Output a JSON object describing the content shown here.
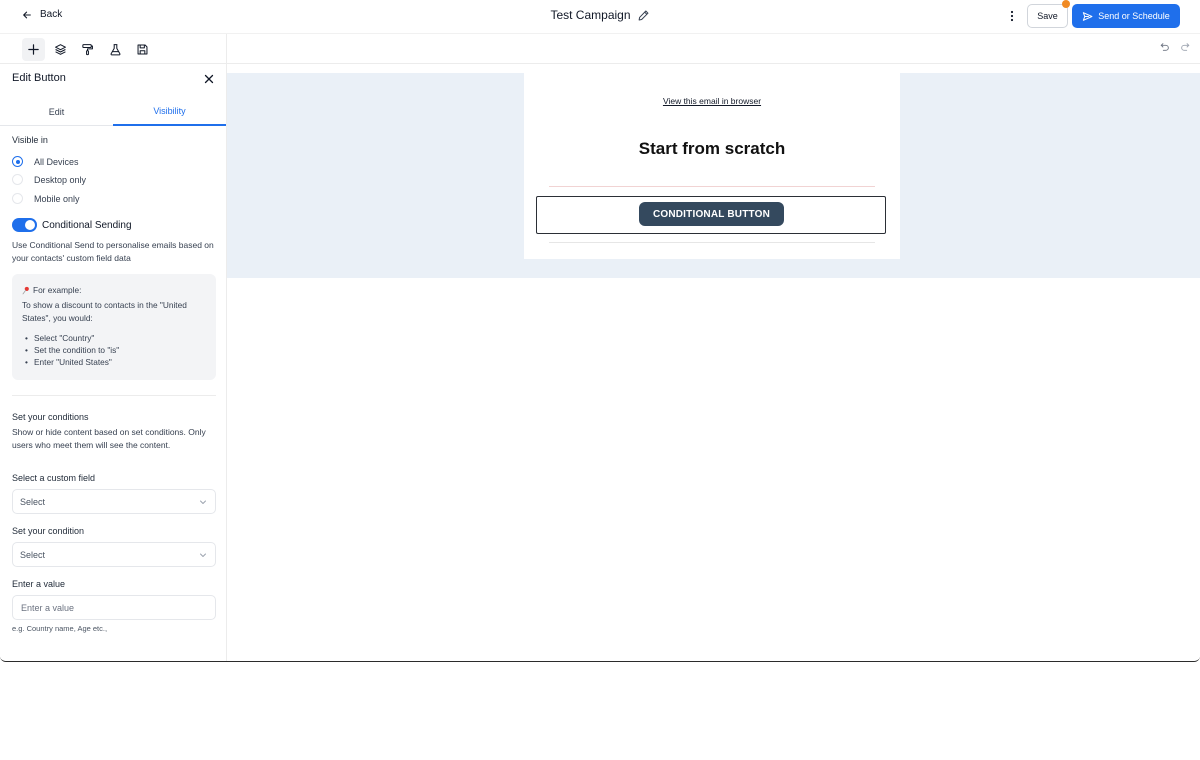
{
  "header": {
    "back_label": "Back",
    "title": "Test Campaign",
    "save_label": "Save",
    "send_label": "Send or Schedule"
  },
  "colors": {
    "accent": "#1f6feb",
    "notification": "#f08a24",
    "canvas_bg": "#eaf0f7",
    "button_bg": "#34495e"
  },
  "toolbar": {
    "tools": [
      "plus-icon",
      "layers-icon",
      "paint-roller-icon",
      "flask-icon",
      "save-disk-icon"
    ],
    "undo_icon": "undo-icon",
    "redo_icon": "redo-icon"
  },
  "panel": {
    "title": "Edit Button",
    "tabs": [
      {
        "label": "Edit",
        "active": false
      },
      {
        "label": "Visibility",
        "active": true
      }
    ],
    "visible_in_label": "Visible in",
    "visibility_options": [
      {
        "label": "All Devices",
        "selected": true
      },
      {
        "label": "Desktop only",
        "selected": false
      },
      {
        "label": "Mobile only",
        "selected": false
      }
    ],
    "conditional_label": "Conditional Sending",
    "conditional_on": true,
    "conditional_desc": "Use Conditional Send to personalise emails based on your contacts' custom field data",
    "example": {
      "heading": "For example:",
      "intro": "To show a discount to contacts in the \"United States\", you would:",
      "steps": [
        "Select \"Country\"",
        "Set the condition to \"is\"",
        "Enter \"United States\""
      ]
    },
    "conditions_title": "Set your conditions",
    "conditions_desc": "Show or hide content based on set conditions. Only users who meet them will see the content.",
    "custom_field_label": "Select a custom field",
    "custom_field_value": "Select",
    "condition_label": "Set your condition",
    "condition_value": "Select",
    "value_label": "Enter a value",
    "value_placeholder": "Enter a value",
    "value_hint": "e.g. Country name, Age etc.,"
  },
  "email": {
    "view_link": "View this email in browser",
    "heading": "Start from scratch",
    "button_label": "CONDITIONAL BUTTON"
  }
}
